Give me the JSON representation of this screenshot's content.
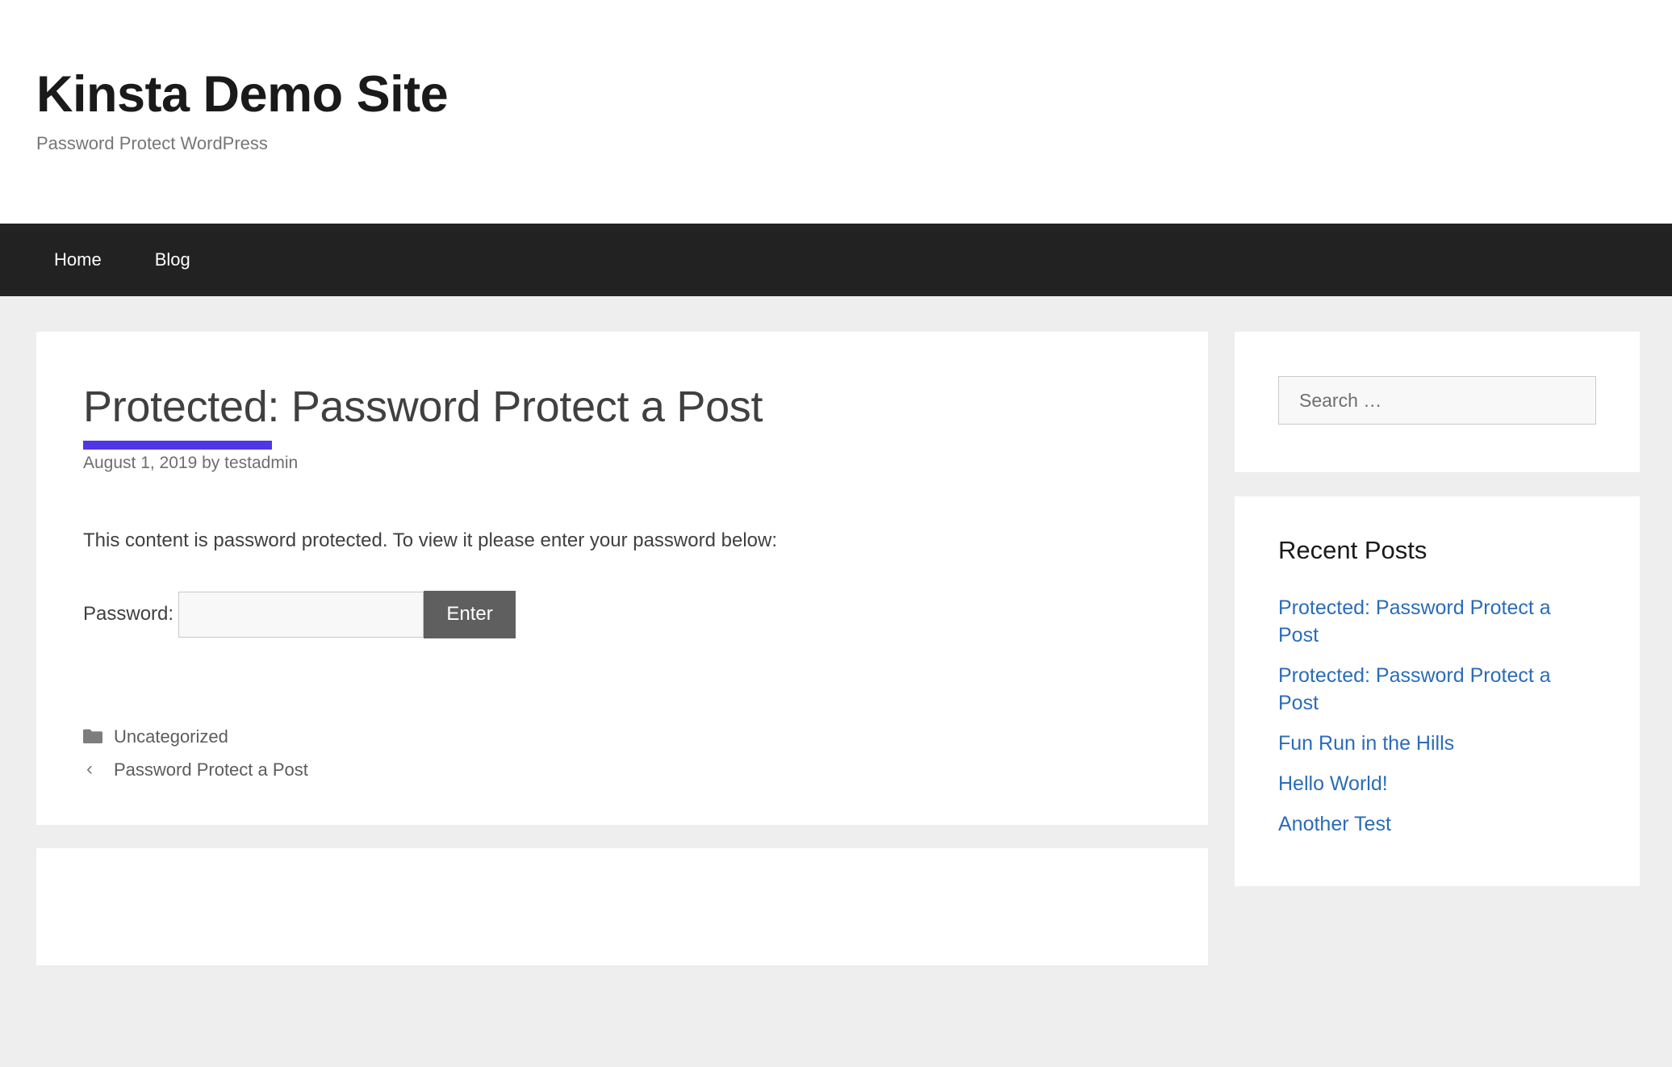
{
  "site": {
    "title": "Kinsta Demo Site",
    "tagline": "Password Protect WordPress"
  },
  "nav": {
    "items": [
      {
        "label": "Home"
      },
      {
        "label": "Blog"
      }
    ]
  },
  "post": {
    "title": "Protected: Password Protect a Post",
    "meta": "August 1, 2019 by testadmin",
    "protected_notice": "This content is password protected. To view it please enter your password below:",
    "accent_color": "#4f37e8",
    "password_form": {
      "label": "Password:",
      "value": "",
      "placeholder": "",
      "submit_label": "Enter"
    },
    "footer": {
      "category_icon": "folder-icon",
      "category": "Uncategorized",
      "prev_icon": "chevron-left-icon",
      "prev_post": "Password Protect a Post"
    }
  },
  "sidebar": {
    "search": {
      "icon": "search-icon",
      "placeholder": "Search …",
      "value": ""
    },
    "recent_posts": {
      "title": "Recent Posts",
      "items": [
        {
          "label": "Protected: Password Protect a Post"
        },
        {
          "label": "Protected: Password Protect a Post"
        },
        {
          "label": "Fun Run in the Hills"
        },
        {
          "label": "Hello World!"
        },
        {
          "label": "Another Test"
        }
      ],
      "link_color": "#2b6cb8"
    }
  }
}
